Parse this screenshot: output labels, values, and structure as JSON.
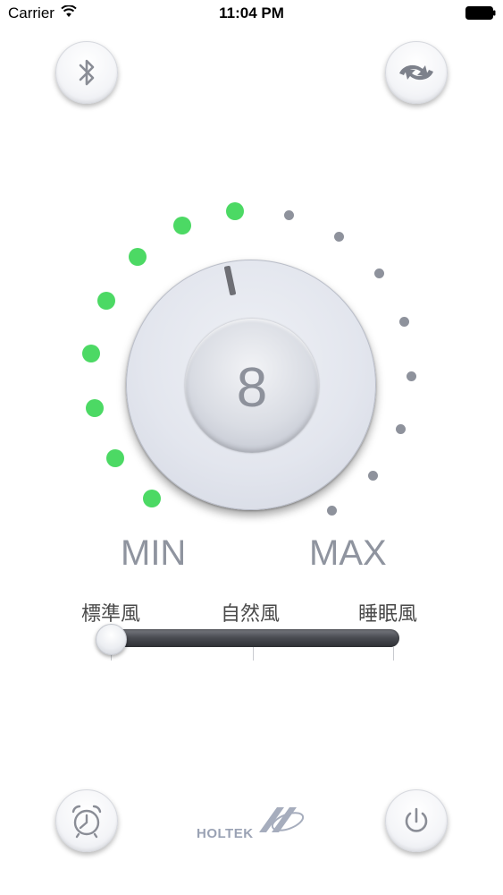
{
  "status_bar": {
    "carrier": "Carrier",
    "time": "11:04 PM"
  },
  "toolbar": {
    "bluetooth_icon": "bluetooth-icon",
    "rotate_icon": "swing-rotate-icon"
  },
  "dial": {
    "value": "8",
    "level": 8,
    "total_steps": 16,
    "min_label": "MIN",
    "max_label": "MAX",
    "active_color": "#4cd964",
    "inactive_color": "#8e929c"
  },
  "mode_slider": {
    "labels": [
      "標準風",
      "自然風",
      "睡眠風"
    ],
    "selected_index": 0,
    "track_color": "#4b4d53"
  },
  "footer": {
    "timer_icon": "alarm-clock-icon",
    "power_icon": "power-icon",
    "logo_text": "HOLTEK"
  }
}
